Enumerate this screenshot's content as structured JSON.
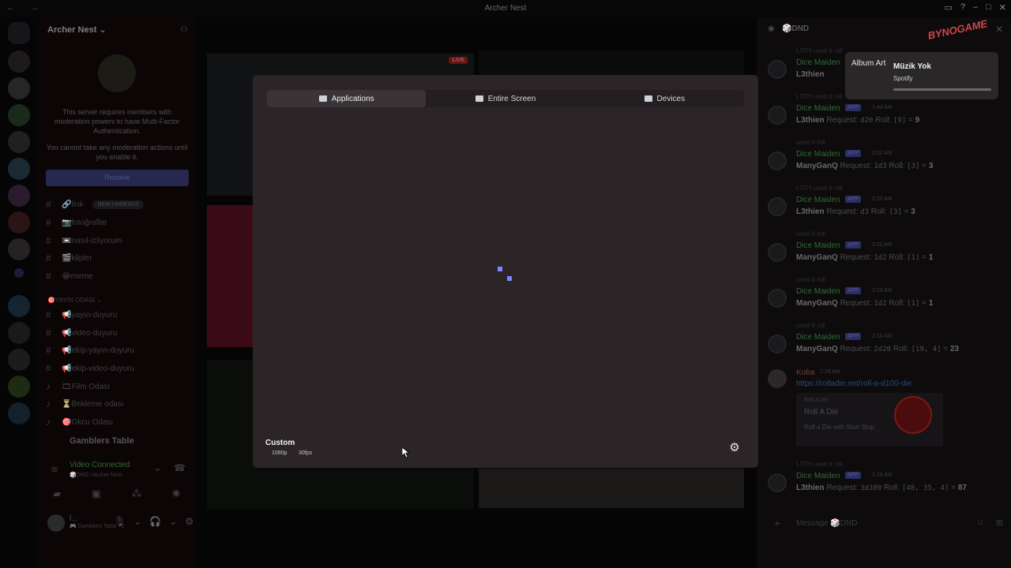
{
  "window": {
    "title": "Archer Nest",
    "nav": "← →"
  },
  "server": {
    "name": "Archer Nest ⌄",
    "mfa_notice": "This server requires members with moderation powers to have Multi-Factor Authentication.",
    "mfa_warning": "You cannot take any moderation actions until you enable it.",
    "resolve_label": "Resolve"
  },
  "channels": [
    {
      "name": "🔗link",
      "badge": "NEW UNREADS"
    },
    {
      "name": "📷fotoğraflar"
    },
    {
      "name": "📼nasıl-izliyorum"
    },
    {
      "name": "🎬klipler"
    },
    {
      "name": "😂meme"
    }
  ],
  "category": "🎯YAYIN ODASI ⌄",
  "channels2": [
    {
      "name": "📢yayın-duyuru"
    },
    {
      "name": "📢video-duyuru"
    },
    {
      "name": "📢ekip-yayın-duyuru"
    },
    {
      "name": "📢ekip-video-duyuru"
    },
    {
      "name": "🎞Film Odası"
    },
    {
      "name": "⏳Bekleme odası"
    },
    {
      "name": "🎯Okcu Odası"
    }
  ],
  "voice": {
    "channel": "Gamblers Table",
    "connected": "Video Connected",
    "location": "🎲DND / Archer Nest"
  },
  "user": {
    "name": "l...",
    "status": "🎮 Gamblers Table +1"
  },
  "stage": {
    "live_label": "LIVE"
  },
  "modal": {
    "tabs": [
      "Applications",
      "Entire Screen",
      "Devices"
    ],
    "quality_title": "Custom",
    "resolution": "1080p",
    "fps": "30fps"
  },
  "chat": {
    "channel": "🎲DND",
    "brand": "BYNOGAME",
    "messages": [
      {
        "user_ref": "L3TH",
        "cmd": "roll",
        "author": "Dice Maiden",
        "app": "APP",
        "time": "",
        "roller": "L3thien",
        "request": "",
        "roll": "",
        "total": ""
      },
      {
        "user_ref": "L3TH",
        "cmd": "roll",
        "author": "Dice Maiden",
        "app": "APP",
        "time": "1:44 AM",
        "roller": "L3thien",
        "request": "d20",
        "roll": "[9]",
        "total": "9"
      },
      {
        "user_ref": "L3TH",
        "cmd": "roll",
        "author": "Dice Maiden",
        "app": "APP",
        "time": "2:02 AM",
        "roller": "ManyGanQ",
        "request": "1d3",
        "roll": "[3]",
        "total": "3"
      },
      {
        "user_ref": "L3TH",
        "cmd": "roll",
        "author": "Dice Maiden",
        "app": "APP",
        "time": "2:02 AM",
        "roller": "L3thien",
        "request": "d3",
        "roll": "[3]",
        "total": "3"
      },
      {
        "user_ref": "",
        "cmd": "roll",
        "author": "Dice Maiden",
        "app": "APP",
        "time": "2:02 AM",
        "roller": "ManyGanQ",
        "request": "1d2",
        "roll": "[1]",
        "total": "1"
      },
      {
        "user_ref": "",
        "cmd": "roll",
        "author": "Dice Maiden",
        "app": "APP",
        "time": "2:03 AM",
        "roller": "ManyGanQ",
        "request": "1d2",
        "roll": "[1]",
        "total": "1"
      },
      {
        "user_ref": "",
        "cmd": "roll",
        "author": "Dice Maiden",
        "app": "APP",
        "time": "2:10 AM",
        "roller": "ManyGanQ",
        "request": "2d20",
        "roll": "[19, 4]",
        "total": "23"
      }
    ],
    "koba": {
      "author": "Koba",
      "time": "2:28 AM",
      "link": "https://rolladie.net/roll-a-d100-die",
      "embed_provider": "Roll a Die",
      "embed_title": "Roll A Die",
      "embed_desc": "Roll a Die with Start Stop"
    },
    "last": {
      "user_ref": "L3TH",
      "cmd": "roll",
      "author": "Dice Maiden",
      "app": "APP",
      "time": "2:29 AM",
      "roller": "L3thien",
      "request": "3d100",
      "roll": "[48, 35, 4]",
      "total": "87"
    },
    "composer_placeholder": "Message 🎲DND"
  },
  "spotify": {
    "art_alt": "Album Art",
    "song": "Müzik Yok",
    "artist": "Spotify",
    "progress": 0
  },
  "icons": [
    "discord-icon",
    "search-icon",
    "gear-icon",
    "mic-icon",
    "headphones-icon",
    "camera-icon",
    "screen-icon"
  ]
}
